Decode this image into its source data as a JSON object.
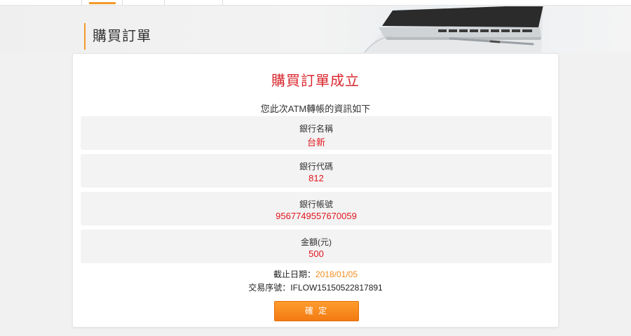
{
  "page": {
    "title": "購買訂單"
  },
  "result": {
    "title": "購買訂單成立",
    "subtitle": "您此次ATM轉帳的資訊如下"
  },
  "info": [
    {
      "label": "銀行名稱",
      "value": "台新"
    },
    {
      "label": "銀行代碼",
      "value": "812"
    },
    {
      "label": "銀行帳號",
      "value": "9567749557670059"
    },
    {
      "label": "金額(元)",
      "value": "500"
    }
  ],
  "deadline": {
    "label": "截止日期：",
    "value": "2018/01/05"
  },
  "transaction": {
    "label": "交易序號：",
    "value": "IFLOW15150522817891"
  },
  "confirm_label": "確 定",
  "colors": {
    "accent": "#f39a2b",
    "error_red": "#e0151d",
    "button_orange": "#f27a12"
  },
  "icons": [
    "laptop-image",
    "pen-image"
  ]
}
